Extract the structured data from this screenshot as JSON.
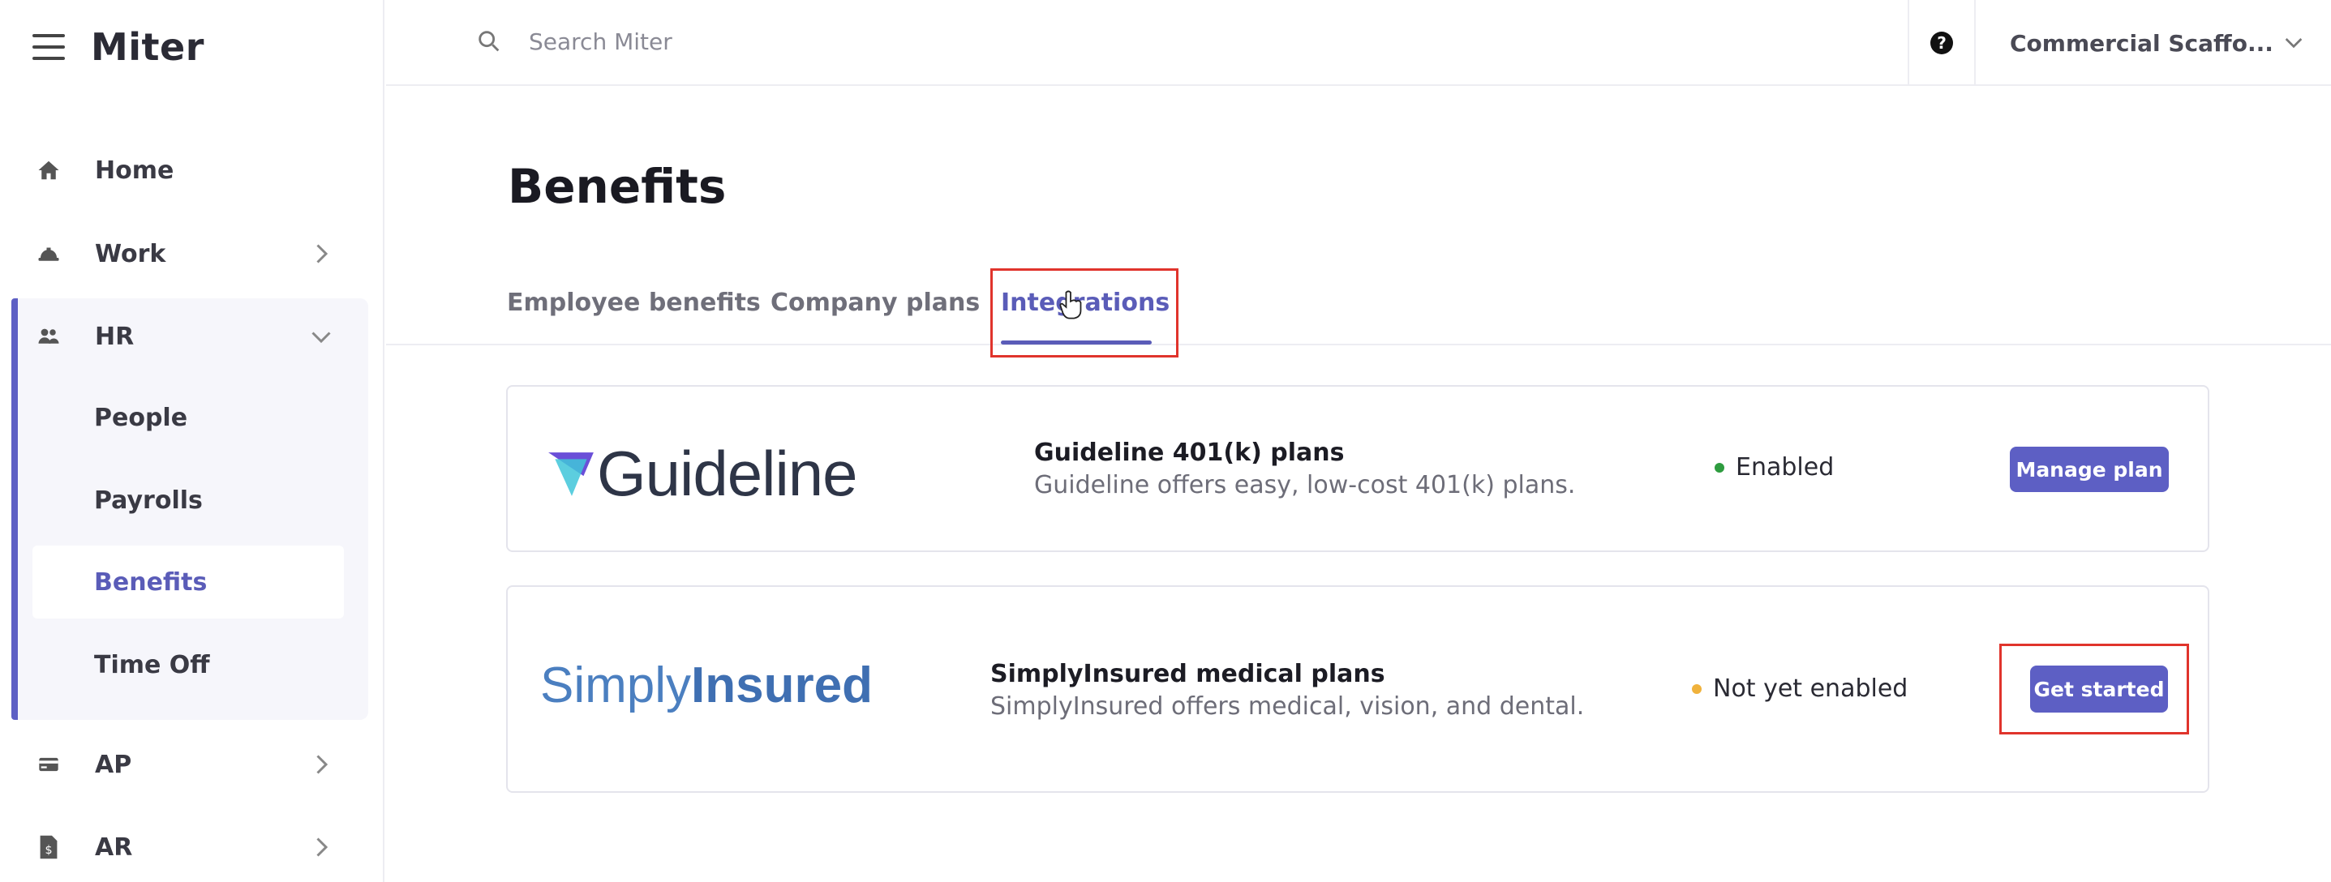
{
  "app": {
    "name": "Miter"
  },
  "sidebar": {
    "items": [
      {
        "label": "Home",
        "icon": "home-icon"
      },
      {
        "label": "Work",
        "icon": "hard-hat-icon"
      },
      {
        "label": "HR",
        "icon": "people-icon"
      },
      {
        "label": "AP",
        "icon": "credit-card-icon"
      },
      {
        "label": "AR",
        "icon": "invoice-icon"
      }
    ],
    "hr_subitems": [
      {
        "label": "People"
      },
      {
        "label": "Payrolls"
      },
      {
        "label": "Benefits",
        "active": true
      },
      {
        "label": "Time Off"
      }
    ]
  },
  "topbar": {
    "search_placeholder": "Search Miter",
    "help_label": "?",
    "company": "Commercial Scaffo..."
  },
  "page": {
    "title": "Benefits",
    "tabs": [
      {
        "label": "Employee benefits"
      },
      {
        "label": "Company plans"
      },
      {
        "label": "Integrations",
        "active": true
      }
    ]
  },
  "integrations": [
    {
      "logo_text": "Guideline",
      "title": "Guideline 401(k) plans",
      "description": "Guideline offers easy, low-cost 401(k) plans.",
      "status": "Enabled",
      "status_color": "#2e9c3f",
      "button": "Manage plan"
    },
    {
      "logo_text_1": "Simply",
      "logo_text_2": "Insured",
      "title": "SimplyInsured medical plans",
      "description": "SimplyInsured offers medical, vision, and dental.",
      "status": "Not yet enabled",
      "status_color": "#f0b23c",
      "button": "Get started"
    }
  ],
  "colors": {
    "accent": "#5d5fc4",
    "highlight": "#e0342c"
  }
}
